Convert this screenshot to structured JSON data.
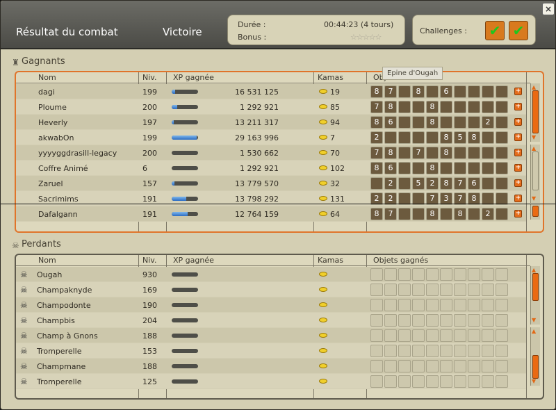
{
  "header": {
    "title": "Résultat du combat",
    "result": "Victoire",
    "duration_label": "Durée :",
    "duration_value": "00:44:23 (4 tours)",
    "bonus_label": "Bonus :",
    "bonus_stars": "☆☆☆☆☆",
    "challenges_label": "Challenges :",
    "close_symbol": "×"
  },
  "colors": {
    "accent": "#e0742a",
    "xp_bar": "#2c6cc2",
    "kamas_coin": "#f0cf2b"
  },
  "winners": {
    "title": "Gagnants",
    "columns": {
      "name": "Nom",
      "level": "Niv.",
      "xp": "XP gagnée",
      "kamas": "Kamas",
      "objects": "Obj"
    },
    "tooltip": "Epine d'Ougah",
    "rows": [
      {
        "name": "dagi",
        "level": "199",
        "xp": "16 531 125",
        "kamas": "19",
        "xp_fill": 0.12
      },
      {
        "name": "Ploume",
        "level": "200",
        "xp": "1 292 921",
        "kamas": "85",
        "xp_fill": 0.22
      },
      {
        "name": "Heverly",
        "level": "197",
        "xp": "13 211 317",
        "kamas": "94",
        "xp_fill": 0.08
      },
      {
        "name": "akwabOn",
        "level": "199",
        "xp": "29 163 996",
        "kamas": "7",
        "xp_fill": 0.95
      },
      {
        "name": "yyyyggdrasill-legacy",
        "level": "200",
        "xp": "1 530 662",
        "kamas": "70",
        "xp_fill": 0.0
      },
      {
        "name": "Coffre Animé",
        "level": "6",
        "xp": "1 292 921",
        "kamas": "102",
        "xp_fill": 0.0
      },
      {
        "name": "Zaruel",
        "level": "157",
        "xp": "13 779 570",
        "kamas": "32",
        "xp_fill": 0.1
      },
      {
        "name": "Sacrimims",
        "level": "191",
        "xp": "13 798 292",
        "kamas": "131",
        "xp_fill": 0.55
      },
      {
        "name": "Dafalgann",
        "level": "191",
        "xp": "12 764 159",
        "kamas": "64",
        "xp_fill": 0.6
      }
    ]
  },
  "losers": {
    "title": "Perdants",
    "columns": {
      "name": "Nom",
      "level": "Niv.",
      "xp": "XP gagnée",
      "kamas": "Kamas",
      "objects": "Objets gagnés"
    },
    "rows": [
      {
        "name": "Ougah",
        "level": "930"
      },
      {
        "name": "Champaknyde",
        "level": "169"
      },
      {
        "name": "Champodonte",
        "level": "190"
      },
      {
        "name": "Champbis",
        "level": "204"
      },
      {
        "name": "Champ à Gnons",
        "level": "188"
      },
      {
        "name": "Tromperelle",
        "level": "153"
      },
      {
        "name": "Champmane",
        "level": "188"
      },
      {
        "name": "Tromperelle",
        "level": "125"
      }
    ]
  },
  "item_counts": {
    "row0": [
      "8",
      "7",
      "",
      "8",
      "",
      "6",
      "",
      "",
      "",
      ""
    ],
    "row1": [
      "7",
      "8",
      "",
      "",
      "8",
      "",
      "",
      "",
      "",
      ""
    ],
    "row2": [
      "8",
      "6",
      "",
      "",
      "8",
      "",
      "",
      "",
      "2",
      ""
    ],
    "row3": [
      "2",
      "",
      "",
      "",
      "",
      "8",
      "5",
      "8",
      "",
      ""
    ],
    "row4": [
      "7",
      "8",
      "",
      "7",
      "",
      "8",
      "",
      "",
      "",
      ""
    ],
    "row5": [
      "8",
      "6",
      "",
      "",
      "8",
      "",
      "",
      "",
      "",
      ""
    ],
    "row6": [
      "",
      "2",
      "",
      "5",
      "2",
      "8",
      "7",
      "6",
      "",
      ""
    ],
    "row7": [
      "2",
      "2",
      "",
      "",
      "7",
      "3",
      "7",
      "8",
      "",
      ""
    ],
    "row8": [
      "8",
      "7",
      "",
      "",
      "8",
      "",
      "8",
      "",
      "2",
      ""
    ]
  }
}
